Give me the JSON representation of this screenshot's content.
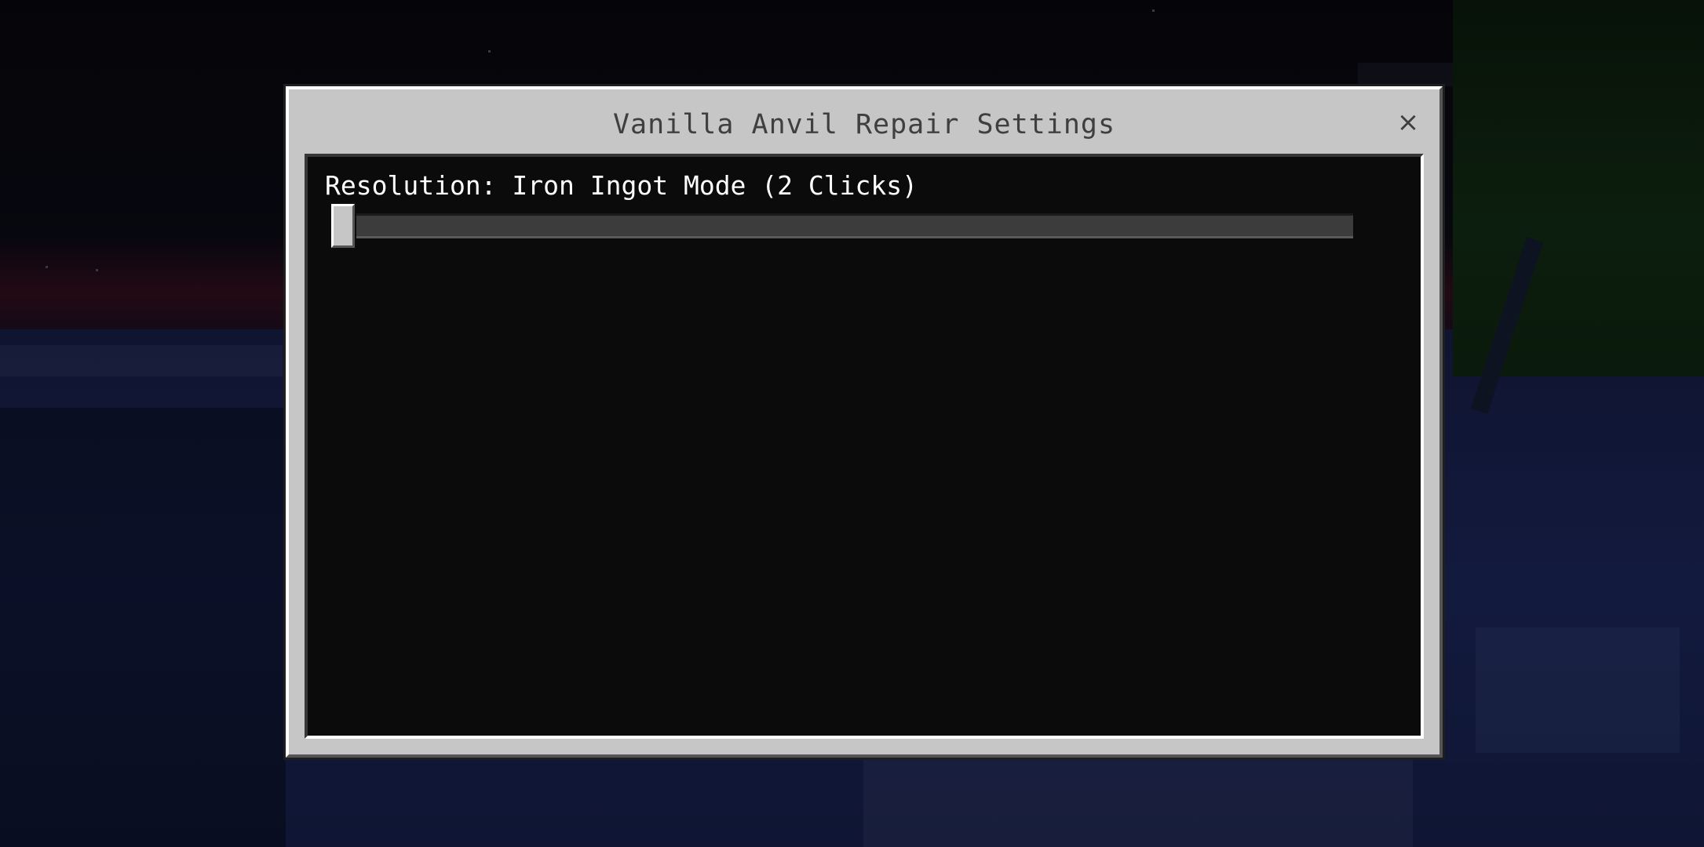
{
  "dialog": {
    "title": "Vanilla Anvil Repair Settings",
    "close_glyph": "×"
  },
  "setting": {
    "label": "Resolution: Iron Ingot Mode (2 Clicks)",
    "slider_value_fraction": 0.0
  },
  "icons": {
    "close": "close-icon"
  },
  "colors": {
    "dialog_bg": "#c6c6c6",
    "panel_bg": "#0b0b0b",
    "title_text": "#3f3f3f",
    "label_text": "#ffffff"
  }
}
